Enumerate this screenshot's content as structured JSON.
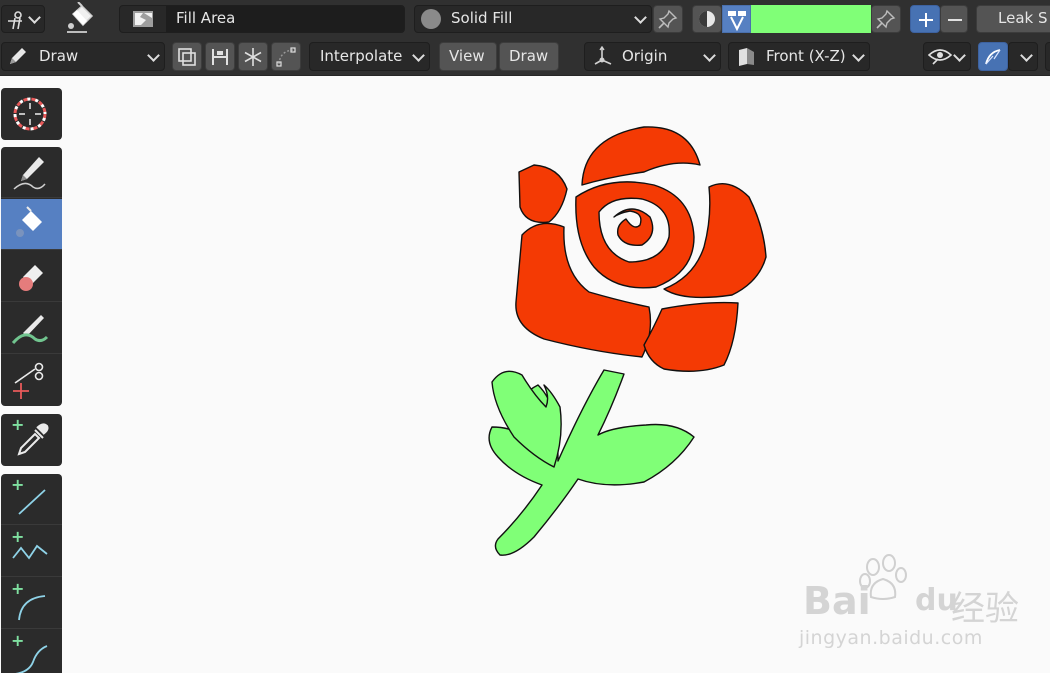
{
  "header": {
    "mode_icon": "grease-pencil-object-icon",
    "tool_icon": "fill-bucket-icon",
    "brush_name": "Fill Area",
    "material_name": "Solid Fill",
    "leak_label": "Leak S",
    "fill_color": "#80ff77"
  },
  "toolbar2": {
    "draw_mode": "Draw",
    "interpolate": "Interpolate",
    "view_tab": "View",
    "draw_tab": "Draw",
    "origin": "Origin",
    "orientation": "Front (X-Z)"
  },
  "tools": [
    {
      "name": "cursor",
      "icon": "cursor-icon"
    },
    {
      "name": "draw",
      "icon": "pencil-icon"
    },
    {
      "name": "fill",
      "icon": "fill-bucket-icon",
      "active": true
    },
    {
      "name": "erase",
      "icon": "eraser-icon"
    },
    {
      "name": "tint",
      "icon": "brush-tint-icon"
    },
    {
      "name": "cutter",
      "icon": "scissors-icon"
    },
    {
      "name": "eyedropper",
      "icon": "eyedropper-icon"
    },
    {
      "name": "line",
      "icon": "line-icon"
    },
    {
      "name": "polyline",
      "icon": "polyline-icon"
    },
    {
      "name": "arc",
      "icon": "arc-icon"
    },
    {
      "name": "curve",
      "icon": "curve-icon"
    }
  ],
  "canvas": {
    "background": "#fafafa",
    "rose_color": "#f43a04",
    "stem_color": "#80ff77"
  },
  "watermark": {
    "line1_latin": "Bai",
    "line1_latin2": "du",
    "line1_cn": "经验",
    "line2": "jingyan.baidu.com"
  }
}
